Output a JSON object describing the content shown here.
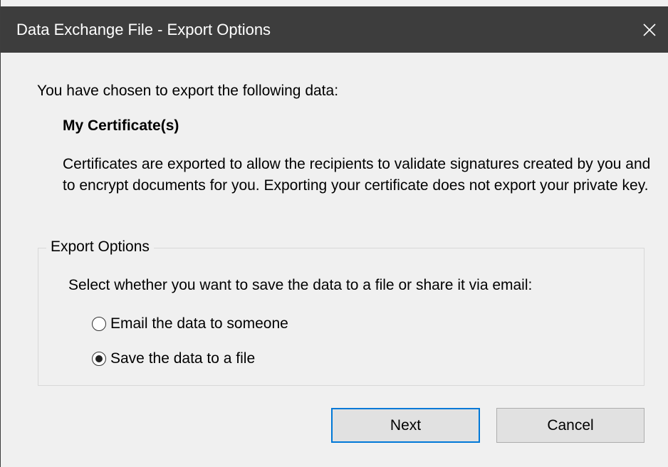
{
  "window": {
    "title": "Data Exchange File - Export Options",
    "close_icon": "close-icon"
  },
  "content": {
    "intro": "You have chosen to export the following data:",
    "data_item": "My Certificate(s)",
    "description": "Certificates are exported to allow the recipients to validate signatures created by you and to encrypt documents for you. Exporting your certificate does not export your private key."
  },
  "export_options": {
    "legend": "Export Options",
    "instruction": "Select whether you want to save the data to a file or share it via email:",
    "options": [
      {
        "label": "Email the data to someone",
        "selected": false
      },
      {
        "label": "Save the data to a file",
        "selected": true
      }
    ]
  },
  "buttons": {
    "next": "Next",
    "cancel": "Cancel"
  },
  "colors": {
    "titlebar": "#3d3d3d",
    "background": "#f0f0f0",
    "focus_border": "#0078d7"
  }
}
